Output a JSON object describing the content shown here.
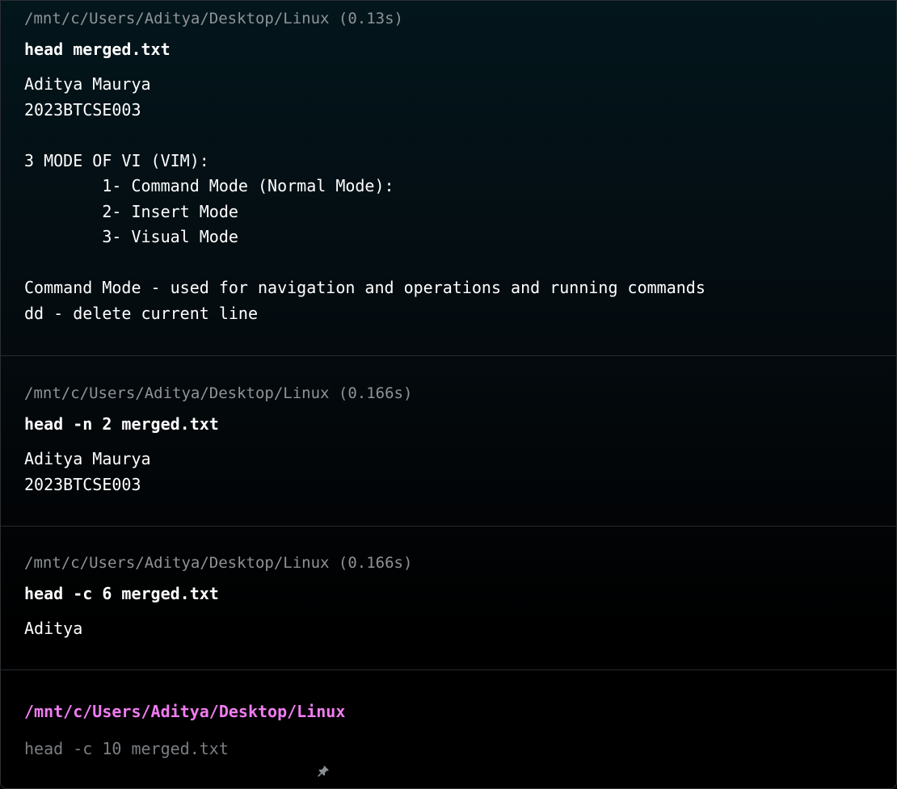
{
  "blocks": [
    {
      "prompt": "/mnt/c/Users/Aditya/Desktop/Linux (0.13s)",
      "command": "head merged.txt",
      "output": "Aditya Maurya\n2023BTCSE003\n\n3 MODE OF VI (VIM):\n        1- Command Mode (Normal Mode):\n        2- Insert Mode\n        3- Visual Mode\n\nCommand Mode - used for navigation and operations and running commands\ndd - delete current line"
    },
    {
      "prompt": "/mnt/c/Users/Aditya/Desktop/Linux (0.166s)",
      "command": "head -n 2 merged.txt",
      "output": "Aditya Maurya\n2023BTCSE003"
    },
    {
      "prompt": "/mnt/c/Users/Aditya/Desktop/Linux (0.166s)",
      "command": "head -c 6 merged.txt",
      "output": "Aditya"
    }
  ],
  "active": {
    "cwd": "/mnt/c/Users/Aditya/Desktop/Linux",
    "input": "head -c 10 merged.txt",
    "input_icon": "pin-icon"
  },
  "colors": {
    "cwd_accent": "#f07cf0",
    "prompt_meta": "#8e9396",
    "typed_input": "#7a7f82"
  }
}
